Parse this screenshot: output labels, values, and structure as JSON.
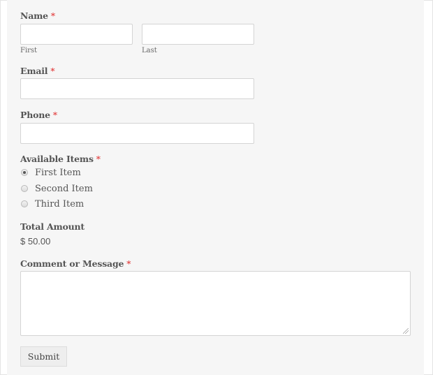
{
  "form": {
    "name": {
      "label": "Name",
      "required_mark": "*",
      "first_value": "",
      "first_sublabel": "First",
      "last_value": "",
      "last_sublabel": "Last"
    },
    "email": {
      "label": "Email",
      "required_mark": "*",
      "value": ""
    },
    "phone": {
      "label": "Phone",
      "required_mark": "*",
      "value": ""
    },
    "items": {
      "label": "Available Items",
      "required_mark": "*",
      "options": [
        {
          "label": "First Item",
          "checked": true
        },
        {
          "label": "Second Item",
          "checked": false
        },
        {
          "label": "Third Item",
          "checked": false
        }
      ]
    },
    "total": {
      "label": "Total Amount",
      "value": "$ 50.00"
    },
    "comment": {
      "label": "Comment or Message",
      "required_mark": "*",
      "value": ""
    },
    "submit_label": "Submit"
  },
  "colors": {
    "required": "#e02c2c",
    "panel": "#f6f6f6"
  }
}
